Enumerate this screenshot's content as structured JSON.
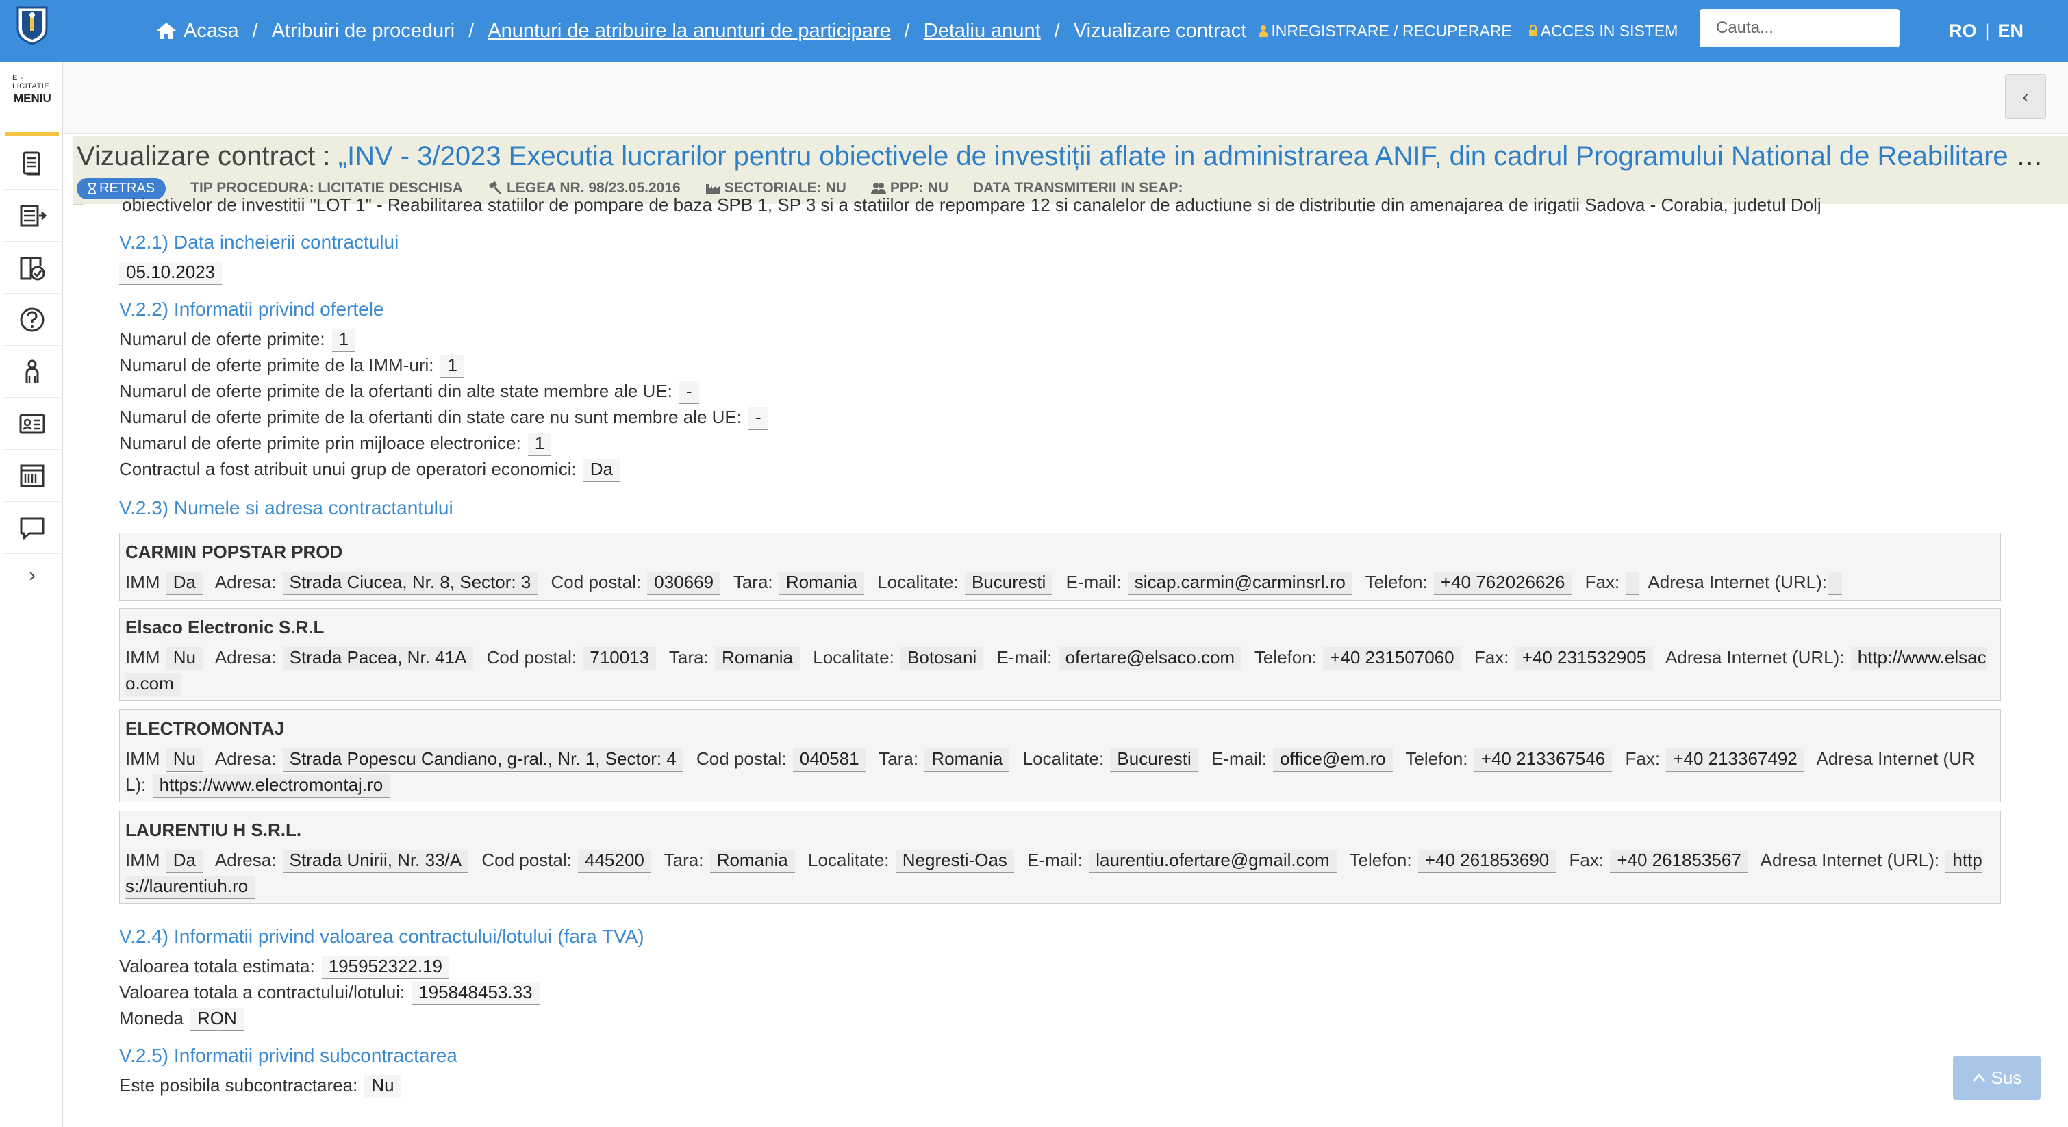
{
  "header": {
    "logo": "crest-logo",
    "breadcrumbs": [
      {
        "label": "Acasa",
        "icon": "home-icon",
        "link": false
      },
      {
        "label": "Atribuiri de proceduri",
        "link": false
      },
      {
        "label": "Anunturi de atribuire la anunturi de participare",
        "link": true
      },
      {
        "label": "Detaliu anunt",
        "link": true
      },
      {
        "label": "Vizualizare contract",
        "link": false
      }
    ],
    "register_label": "INREGISTRARE / RECUPERARE",
    "login_label": "ACCES IN SISTEM",
    "search_placeholder": "Cauta...",
    "lang_ro": "RO",
    "lang_sep": "|",
    "lang_en": "EN",
    "collapse_label": "‹"
  },
  "sidebar": {
    "brand_top": "E - LICITATIE",
    "brand_menu": "MENIU",
    "items": [
      "document-icon",
      "list-arrow-icon",
      "book-check-icon",
      "help-icon",
      "person-icon",
      "id-card-icon",
      "catalog-icon",
      "chat-icon"
    ],
    "expand_label": "›"
  },
  "title": {
    "label": "Vizualizare contract :",
    "value": "„INV - 3/2023 Executia lucrarilor pentru obiectivele de investiții aflate in administrarea ANIF, din cadrul Programului National de Reabilitare a ...",
    "status": "RETRAS",
    "meta": [
      {
        "label": "TIP PROCEDURA: LICITATIE DESCHISA",
        "icon": ""
      },
      {
        "label": "LEGEA NR. 98/23.05.2016",
        "icon": "hammer-icon"
      },
      {
        "label": "SECTORIALE: NU",
        "icon": "factory-icon"
      },
      {
        "label": "PPP: NU",
        "icon": "users-icon"
      },
      {
        "label": "DATA TRANSMITERII IN SEAP:",
        "icon": ""
      }
    ]
  },
  "content": {
    "cut_text": "obiectivelor de investitii \"LOT 1\" - Reabilitarea statiilor de pompare de baza SPB 1, SP 3 si a statiilor de repompare 12 si canalelor de aductiune si de distributie din amenajarea de irigatii Sadova - Corabia, judetul Dolj",
    "sections": {
      "v221": {
        "title": "V.2.1) Data incheierii contractului",
        "date": "05.10.2023"
      },
      "v222": {
        "title": "V.2.2) Informatii privind ofertele",
        "rows": [
          {
            "label": "Numarul de oferte primite:",
            "value": "1"
          },
          {
            "label": "Numarul de oferte primite de la IMM-uri:",
            "value": "1"
          },
          {
            "label": "Numarul de oferte primite de la ofertanti din alte state membre ale UE:",
            "value": "-"
          },
          {
            "label": "Numarul de oferte primite de la ofertanti din state care nu sunt membre ale UE:",
            "value": "-"
          },
          {
            "label": "Numarul de oferte primite prin mijloace electronice:",
            "value": "1"
          },
          {
            "label": "Contractul a fost atribuit unui grup de operatori economici:",
            "value": "Da"
          }
        ]
      },
      "v223": {
        "title": "V.2.3) Numele si adresa contractantului",
        "labels": {
          "imm": "IMM",
          "adresa": "Adresa:",
          "cod": "Cod postal:",
          "tara": "Tara:",
          "loc": "Localitate:",
          "email": "E-mail:",
          "tel": "Telefon:",
          "fax": "Fax:",
          "url": "Adresa Internet (URL):"
        },
        "operators": [
          {
            "name": "CARMIN POPSTAR PROD",
            "imm": "Da",
            "adresa": "Strada Ciucea, Nr. 8, Sector: 3",
            "cod": "030669",
            "tara": "Romania",
            "loc": "Bucuresti",
            "email": "sicap.carmin@carminsrl.ro",
            "tel": "+40 762026626",
            "fax": "",
            "url": ""
          },
          {
            "name": "Elsaco Electronic S.R.L",
            "imm": "Nu",
            "adresa": "Strada Pacea, Nr. 41A",
            "cod": "710013",
            "tara": "Romania",
            "loc": "Botosani",
            "email": "ofertare@elsaco.com",
            "tel": "+40 231507060",
            "fax": "+40 231532905",
            "url": "http://www.elsaco.com"
          },
          {
            "name": "ELECTROMONTAJ",
            "imm": "Nu",
            "adresa": "Strada Popescu Candiano, g-ral., Nr. 1, Sector: 4",
            "cod": "040581",
            "tara": "Romania",
            "loc": "Bucuresti",
            "email": "office@em.ro",
            "tel": "+40 213367546",
            "fax": "+40 213367492",
            "url": "https://www.electromontaj.ro"
          },
          {
            "name": "LAURENTIU H S.R.L.",
            "imm": "Da",
            "adresa": "Strada Unirii, Nr. 33/A",
            "cod": "445200",
            "tara": "Romania",
            "loc": "Negresti-Oas",
            "email": "laurentiu.ofertare@gmail.com",
            "tel": "+40 261853690",
            "fax": "+40 261853567",
            "url": "https://laurentiuh.ro"
          }
        ]
      },
      "v224": {
        "title": "V.2.4) Informatii privind valoarea contractului/lotului (fara TVA)",
        "estimated_label": "Valoarea totala estimata:",
        "estimated_value": "195952322.19",
        "total_label": "Valoarea totala a contractului/lotului:",
        "total_value": "195848453.33",
        "currency_label": "Moneda",
        "currency_value": "RON"
      },
      "v225": {
        "title": "V.2.5) Informatii privind subcontractarea",
        "label": "Este posibila subcontractarea:",
        "value": "Nu"
      }
    },
    "back_to_top": "Sus"
  },
  "colors": {
    "topbar": "#3c8ddb",
    "section_title": "#3a8ad4",
    "title_value": "#2f7fc8",
    "status_badge": "#3d7fd0",
    "accent": "#f5c242"
  }
}
